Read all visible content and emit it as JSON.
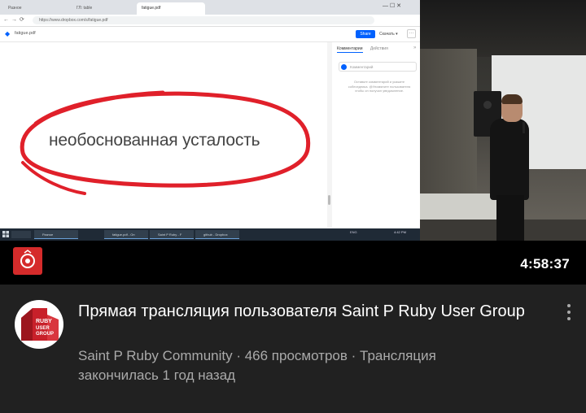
{
  "browser": {
    "tabs": [
      "Разное",
      "ГЛ: table",
      "fatigue.pdf"
    ],
    "url": "https://www.dropbox.com/s/fatigue.pdf",
    "window_controls": "—  ☐  ✕"
  },
  "dropbox": {
    "filename": "fatigue.pdf",
    "share_label": "Share",
    "download_label": "Скачать ▾",
    "more_label": "···"
  },
  "document": {
    "text": "необоснованная усталость",
    "annotation_color": "#e0202a"
  },
  "comments_panel": {
    "tab_comments": "Комментарии",
    "tab_activity": "Действия",
    "placeholder": "Комментарий",
    "hint": "Оставьте комментарий и укажите собеседника. @Упомяните пользователя чтобы он получил уведомление."
  },
  "taskbar": {
    "items": [
      "Разное",
      "fatigue.pdf - Оп",
      "Saint P Ruby - F",
      "github - Dropbox"
    ],
    "tray": "ENG",
    "clock": "4:42 PM"
  },
  "video": {
    "duration": "4:58:37",
    "channel_badge_color": "#d52b2b"
  },
  "info": {
    "avatar_label": "RUBY USER GROUP",
    "title": "Прямая трансляция пользователя Saint P Ruby User Group",
    "meta": "Saint P Ruby Community · 466 просмотров · Трансляция закончилась 1 год назад",
    "more_icon": "vertical-ellipsis-icon"
  }
}
